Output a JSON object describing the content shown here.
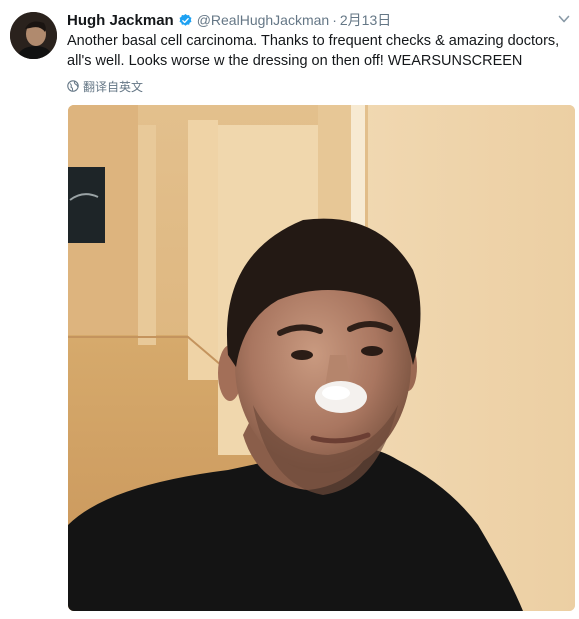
{
  "tweet": {
    "author": {
      "name": "Hugh Jackman",
      "handle": "@RealHughJackman",
      "verified": true
    },
    "separator": "·",
    "date": "2月13日",
    "text_lines": [
      "Another basal cell carcinoma. Thanks to frequent checks & amazing doctors,",
      "all's well. Looks worse w the dressing on then off! WEARSUNSCREEN"
    ],
    "translate_label": "翻译自英文",
    "icons": {
      "verified": "verified-badge-icon",
      "menu": "chevron-down-icon",
      "translate": "globe-icon"
    },
    "colors": {
      "name": "#14171a",
      "secondary": "#657786",
      "verified": "#1da1f2",
      "background": "#ffffff"
    }
  }
}
